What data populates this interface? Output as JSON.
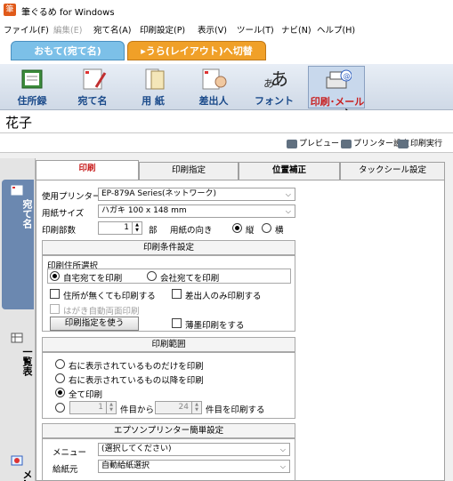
{
  "app": {
    "title": "筆ぐるめ for Windows",
    "icon_glyph": "筆"
  },
  "menubar": [
    "ファイル(F)",
    "編集(E)",
    "宛て名(A)",
    "印刷設定(P)",
    "表示(V)",
    "ツール(T)",
    "ナビ(N)",
    "ヘルプ(H)"
  ],
  "side_tabs": {
    "front": "おもて(宛て名)",
    "back": "▸うら(レイアウト)へ切替"
  },
  "toolbar": [
    "住所録",
    "宛て名",
    "用 紙",
    "差出人",
    "フォント",
    "印刷･メール"
  ],
  "current_name": "花子",
  "actions": [
    "プレビュー",
    "プリンター設定",
    "印刷実行"
  ],
  "left_nav": {
    "atena": "宛て名",
    "ichiran": "一覧表",
    "menu": "メ…"
  },
  "tabs": [
    "印刷",
    "印刷指定",
    "位置補正",
    "タックシール設定"
  ],
  "printer": {
    "label": "使用プリンター",
    "value": "EP-879A Series(ネットワーク)"
  },
  "paper": {
    "label": "用紙サイズ",
    "value": "ハガキ 100 x 148 mm"
  },
  "copies": {
    "label": "印刷部数",
    "value": "1",
    "unit": "部"
  },
  "orientation": {
    "label": "用紙の向き",
    "portrait": "縦",
    "landscape": "横",
    "selected": "portrait"
  },
  "conditions": {
    "header": "印刷条件設定",
    "address_header": "印刷住所選択",
    "home": "自宅宛てを印刷",
    "company": "会社宛てを印刷",
    "print_without_address": "住所が無くても印刷する",
    "sender_only": "差出人のみ印刷する",
    "duplex": "はがき自動両面印刷",
    "use_spec_button": "印刷指定を使う",
    "thin_paper": "薄墨印刷をする"
  },
  "range": {
    "header": "印刷範囲",
    "opt1": "右に表示されているものだけを印刷",
    "opt2": "右に表示されているもの以降を印刷",
    "opt3": "全て印刷",
    "from_value": "1",
    "from_label": "件目から",
    "to_value": "24",
    "to_label": "件目を印刷する",
    "selected": "all"
  },
  "epson": {
    "header": "エプソンプリンター簡単設定",
    "menu_label": "メニュー",
    "menu_value": "(選択してください)",
    "feed_label": "給紙元",
    "feed_value": "自動給紙選択"
  },
  "colors": {
    "accent_blue": "#7cc0e8",
    "accent_orange": "#f0a028",
    "print_red": "#c81e1e",
    "nav_blue": "#6b88b0"
  }
}
